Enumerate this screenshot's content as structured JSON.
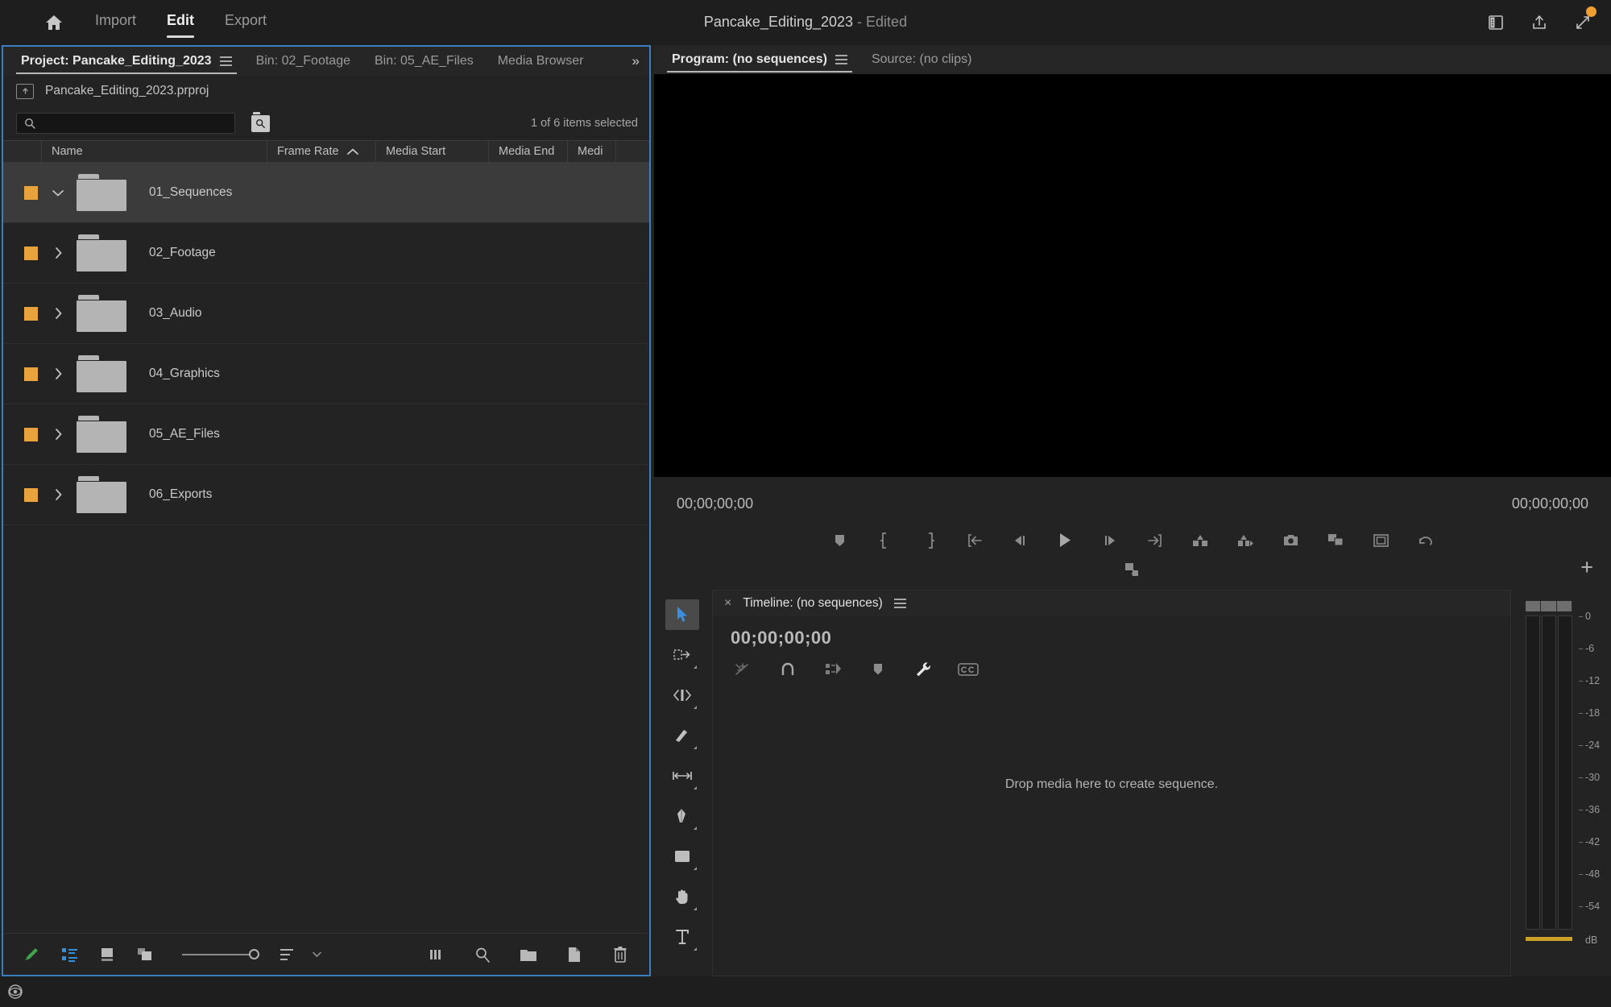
{
  "topbar": {
    "home_icon": "home-icon",
    "nav": [
      {
        "label": "Import",
        "active": false
      },
      {
        "label": "Edit",
        "active": true
      },
      {
        "label": "Export",
        "active": false
      }
    ],
    "title": "Pancake_Editing_2023",
    "title_state": " - Edited",
    "right_icons": [
      "panel-layout-icon",
      "share-icon",
      "fullscreen-icon"
    ],
    "status_dot_color": "#f0a030"
  },
  "project_panel": {
    "tabs": [
      {
        "label": "Project: Pancake_Editing_2023",
        "active": true,
        "has_menu": true
      },
      {
        "label": "Bin: 02_Footage",
        "active": false,
        "has_menu": false
      },
      {
        "label": "Bin: 05_AE_Files",
        "active": false,
        "has_menu": false
      },
      {
        "label": "Media Browser",
        "active": false,
        "has_menu": false
      }
    ],
    "overflow_label": "»",
    "breadcrumb": "Pancake_Editing_2023.prproj",
    "search": {
      "value": "",
      "placeholder": ""
    },
    "selection_status": "1 of 6 items selected",
    "columns": [
      "Name",
      "Frame Rate",
      "Media Start",
      "Media End",
      "Medi"
    ],
    "sort_column": "Frame Rate",
    "sort_direction": "ascending",
    "label_color": "#e8a33d",
    "items": [
      {
        "name": "01_Sequences",
        "expanded": true,
        "selected": true
      },
      {
        "name": "02_Footage",
        "expanded": false,
        "selected": false
      },
      {
        "name": "03_Audio",
        "expanded": false,
        "selected": false
      },
      {
        "name": "04_Graphics",
        "expanded": false,
        "selected": false
      },
      {
        "name": "05_AE_Files",
        "expanded": false,
        "selected": false
      },
      {
        "name": "06_Exports",
        "expanded": false,
        "selected": false
      }
    ],
    "bottom_tools_left": [
      "new-item-pen-icon",
      "list-view-icon",
      "icon-view-icon",
      "freeform-view-icon",
      "zoom-slider",
      "sort-icon",
      "sort-chevron-icon"
    ],
    "bottom_tools_right": [
      "automate-to-sequence-icon",
      "find-icon",
      "new-bin-icon",
      "new-item-icon",
      "delete-icon"
    ]
  },
  "program_panel": {
    "tabs": [
      {
        "label": "Program: (no sequences)",
        "active": true,
        "has_menu": true
      },
      {
        "label": "Source: (no clips)",
        "active": false,
        "has_menu": false
      }
    ],
    "timecode_left": "00;00;00;00",
    "timecode_right": "00;00;00;00",
    "transport_icons": [
      "add-marker-icon",
      "mark-in-icon",
      "mark-out-icon",
      "go-to-in-icon",
      "step-back-icon",
      "play-icon",
      "step-forward-icon",
      "go-to-out-icon",
      "lift-icon",
      "extract-icon",
      "export-frame-icon",
      "comparison-view-icon",
      "safe-margins-icon",
      "undo-icon"
    ],
    "second_row_icon": "button-editor-icon",
    "add_button": "+"
  },
  "tools_panel": {
    "tools": [
      {
        "name": "selection-tool",
        "active": true
      },
      {
        "name": "track-select-forward-tool",
        "active": false
      },
      {
        "name": "ripple-edit-tool",
        "active": false
      },
      {
        "name": "razor-tool",
        "active": false
      },
      {
        "name": "slip-tool",
        "active": false
      },
      {
        "name": "pen-tool",
        "active": false
      },
      {
        "name": "rectangle-tool",
        "active": false
      },
      {
        "name": "hand-tool",
        "active": false
      },
      {
        "name": "type-tool",
        "active": false
      }
    ]
  },
  "timeline_panel": {
    "close_label": "×",
    "title": "Timeline: (no sequences)",
    "timecode": "00;00;00;00",
    "tool_icons": [
      "insert-overwrite-icon",
      "snap-icon",
      "linked-selection-icon",
      "add-marker-icon",
      "timeline-settings-icon",
      "captions-icon"
    ],
    "drop_message": "Drop media here to create sequence."
  },
  "audio_meter": {
    "scale_labels": [
      "0",
      "-6",
      "-12",
      "-18",
      "-24",
      "-30",
      "-36",
      "-42",
      "-48",
      "-54"
    ],
    "unit_label": "dB"
  },
  "statusbar": {
    "icon": "accessibility-icon"
  }
}
